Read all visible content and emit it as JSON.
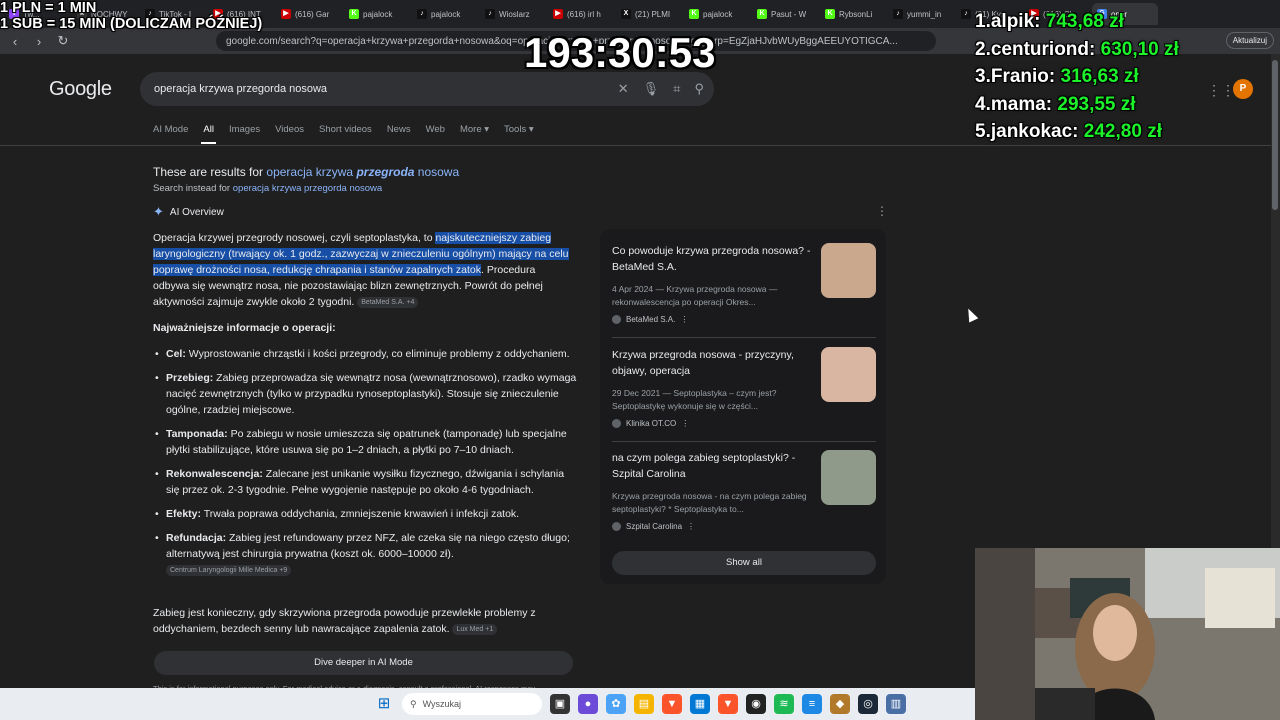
{
  "browser": {
    "tabs": [
      {
        "label": "Tw...",
        "fav_color": "#9146ff",
        "fav": "t"
      },
      {
        "label": "NOCHWY",
        "fav_color": "#333",
        "fav": "k"
      },
      {
        "label": "TikTok - I",
        "fav_color": "#111",
        "fav": "♪"
      },
      {
        "label": "(616) INT",
        "fav_color": "#cc0000",
        "fav": "▶"
      },
      {
        "label": "(616) Gar",
        "fav_color": "#cc0000",
        "fav": "▶"
      },
      {
        "label": "pajalock",
        "fav_color": "#53fc18",
        "fav": "K"
      },
      {
        "label": "pajalock",
        "fav_color": "#111",
        "fav": "♪"
      },
      {
        "label": "Wioslarz",
        "fav_color": "#111",
        "fav": "♪"
      },
      {
        "label": "(616) irl h",
        "fav_color": "#cc0000",
        "fav": "▶"
      },
      {
        "label": "(21) PLMI",
        "fav_color": "#111",
        "fav": "X"
      },
      {
        "label": "pajalock",
        "fav_color": "#53fc18",
        "fav": "K"
      },
      {
        "label": "Pasut - W",
        "fav_color": "#53fc18",
        "fav": "K"
      },
      {
        "label": "RybsonLi",
        "fav_color": "#53fc18",
        "fav": "K"
      },
      {
        "label": "yummi_in",
        "fav_color": "#111",
        "fav": "♪"
      },
      {
        "label": "(21) Kys",
        "fav_color": "#111",
        "fav": "♪"
      },
      {
        "label": "(616) Cl",
        "fav_color": "#cc0000",
        "fav": "▶"
      },
      {
        "label": "oper",
        "fav_color": "#4285f4",
        "fav": "G"
      }
    ],
    "url": "google.com/search?q=operacja+krzywa+przegorda+nosowa&oq=operacja+krzywa+przegorda+nosowa&gs_lcrp=EgZjaHJvbWUyBggAEEUYOTIGCA...",
    "update_label": "Aktualizuj"
  },
  "google": {
    "logo": "Google",
    "query": "operacja krzywa przegorda nosowa",
    "avatar_letter": "P",
    "tabs": [
      "AI Mode",
      "All",
      "Images",
      "Videos",
      "Short videos",
      "News",
      "Web",
      "More ▾",
      "Tools ▾"
    ],
    "results_for_prefix": "These are results for ",
    "results_for_a": "operacja krzywa ",
    "results_for_b": "przegroda",
    "results_for_c": " nosowa",
    "search_instead_prefix": "Search instead for ",
    "search_instead_link": "operacja krzywa przegorda nosowa",
    "ai_overview_title": "AI Overview",
    "aio_p1_start": "Operacja krzywej przegrody nosowej, czyli septoplastyka, to ",
    "aio_p1_hl": "najskuteczniejszy zabieg laryngologiczny (trwający ok. 1 godz., zazwyczaj w znieczuleniu ogólnym) mający na celu poprawę drożności nosa, redukcję chrapania i stanów zapalnych zatok",
    "aio_p1_end": ". Procedura odbywa się wewnątrz nosa, nie pozostawiając blizn zewnętrznych. Powrót do pełnej aktywności zajmuje zwykle około 2 tygodni.",
    "aio_p1_chip": "BetaMed S.A. +4",
    "aio_subhead": "Najważniejsze informacje o operacji:",
    "bullets": [
      {
        "term": "Cel:",
        "text": " Wyprostowanie chrząstki i kości przegrody, co eliminuje problemy z oddychaniem."
      },
      {
        "term": "Przebieg:",
        "text": " Zabieg przeprowadza się wewnątrz nosa (wewnątrznosowo), rzadko wymaga nacięć zewnętrznych (tylko w przypadku rynoseptoplastyki). Stosuje się znieczulenie ogólne, rzadziej miejscowe."
      },
      {
        "term": "Tamponada:",
        "text": " Po zabiegu w nosie umieszcza się opatrunek (tamponadę) lub specjalne płytki stabilizujące, które usuwa się po 1–2 dniach, a płytki po 7–10 dniach."
      },
      {
        "term": "Rekonwalescencja:",
        "text": " Zalecane jest unikanie wysiłku fizycznego, dźwigania i schylania się przez ok. 2-3 tygodnie. Pełne wygojenie następuje po około 4-6 tygodniach."
      },
      {
        "term": "Efekty:",
        "text": " Trwała poprawa oddychania, zmniejszenie krwawień i infekcji zatok."
      },
      {
        "term": "Refundacja:",
        "text": " Zabieg jest refundowany przez NFZ, ale czeka się na niego często długo; alternatywą jest chirurgia prywatna (koszt ok. 6000–10000 zł).",
        "chip": "Centrum Laryngologii Mille Medica +9"
      }
    ],
    "aio_conclusion": "Zabieg jest konieczny, gdy skrzywiona przegroda powoduje przewlekłe problemy z oddychaniem, bezdech senny lub nawracające zapalenia zatok.",
    "aio_conclusion_chip": "Lux Med +1",
    "dive_deeper_label": "Dive deeper in AI Mode",
    "disclaimer": "This is for informational purposes only. For medical advice or a diagnosis, consult a professional. AI responses may",
    "sources": [
      {
        "title": "Co powoduje krzywa przegroda nosowa? - BetaMed S.A.",
        "snippet": "4 Apr 2024 — Krzywa przegroda nosowa — rekonwalescencja po operacji Okres...",
        "site": "BetaMed S.A.",
        "thumb_color": "#c9a88e"
      },
      {
        "title": "Krzywa przegroda nosowa - przyczyny, objawy, operacja",
        "snippet": "29 Dec 2021 — Septoplastyka – czym jest? Septoplastykę wykonuje się w części...",
        "site": "Klinika OT.CO",
        "thumb_color": "#d8b6a2"
      },
      {
        "title": "na czym polega zabieg septoplastyki? - Szpital Carolina",
        "snippet": "Krzywa przegroda nosowa - na czym polega zabieg septoplastyki? * Septoplastyka to...",
        "site": "Szpital Carolina",
        "thumb_color": "#8f9a8a"
      }
    ],
    "show_all_label": "Show all"
  },
  "taskbar": {
    "search_placeholder": "Wyszukaj"
  },
  "overlay": {
    "rules_line1": "1 PLN = 1 MIN",
    "rules_line2": "1 SUB = 15 MIN (DOLICZAM PÓŹNIEJ)",
    "timer": "193:30:53",
    "leaderboard": [
      {
        "rank": "1.",
        "name": "alpik:",
        "amount": "743,68 zł"
      },
      {
        "rank": "2.",
        "name": "centuriond:",
        "amount": "630,10 zł"
      },
      {
        "rank": "3.",
        "name": "Franio:",
        "amount": "316,63 zł"
      },
      {
        "rank": "4.",
        "name": "mama:",
        "amount": "293,55 zł"
      },
      {
        "rank": "5.",
        "name": "jankokac:",
        "amount": "242,80 zł"
      }
    ]
  }
}
